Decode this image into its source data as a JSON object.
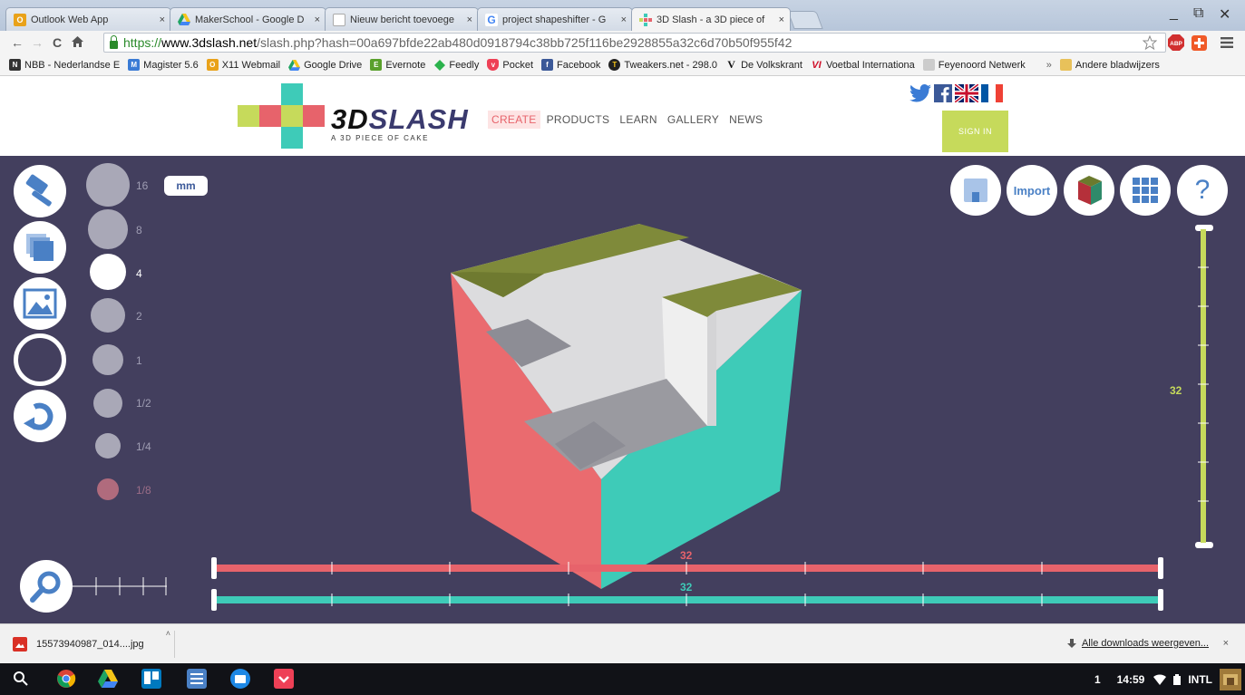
{
  "browser": {
    "tabs": [
      {
        "label": "Outlook Web App",
        "icon": "outlook-icon",
        "color": "#e9a21a"
      },
      {
        "label": "MakerSchool - Google D",
        "icon": "google-drive-icon",
        "color": "#2d8a4a"
      },
      {
        "label": "Nieuw bericht toevoege",
        "icon": "blank-page-icon",
        "color": "#ffffff"
      },
      {
        "label": "project shapeshifter - G",
        "icon": "google-icon",
        "color": "#4285f4"
      },
      {
        "label": "3D Slash - a 3D piece of",
        "icon": "3dslash-icon",
        "color": "#e7636b"
      }
    ],
    "tab_close": "×",
    "window_controls": [
      "_",
      "⧉",
      "✕"
    ],
    "address": {
      "https": "https://",
      "host": "www.3dslash.net",
      "rest": "/slash.php?hash=00a697bfde22ab480d0918794c38bb725f116be2928855a32c6d70b50f955f42"
    },
    "extensions": {
      "adblock": "ABP"
    },
    "bookmarks": [
      {
        "label": "NBB - Nederlandse E",
        "icon": "nbb-icon",
        "color": "#333333"
      },
      {
        "label": "Magister 5.6",
        "icon": "magister-icon",
        "color": "#3a7bd5"
      },
      {
        "label": "X11 Webmail",
        "icon": "webmail-icon",
        "color": "#e9a21a"
      },
      {
        "label": "Google Drive",
        "icon": "google-drive-icon",
        "color": "#2d8a4a"
      },
      {
        "label": "Evernote",
        "icon": "evernote-icon",
        "color": "#5aa02c"
      },
      {
        "label": "Feedly",
        "icon": "feedly-icon",
        "color": "#2bb24c"
      },
      {
        "label": "Pocket",
        "icon": "pocket-icon",
        "color": "#ee4056"
      },
      {
        "label": "Facebook",
        "icon": "facebook-icon",
        "color": "#3b5998"
      },
      {
        "label": "Tweakers.net - 298.0",
        "icon": "tweakers-icon",
        "color": "#222222"
      },
      {
        "label": "De Volkskrant",
        "icon": "volkskrant-icon",
        "color": "#111111"
      },
      {
        "label": "Voetbal Internationa",
        "icon": "vi-icon",
        "color": "#d0112b"
      },
      {
        "label": "Feyenoord Netwerk",
        "icon": "feyenoord-icon",
        "color": "#bbbbbb"
      }
    ],
    "bookmarks_more": "»",
    "other_bookmarks": "Andere bladwijzers"
  },
  "site": {
    "brand_part1": "3D",
    "brand_part2": "SLASH",
    "tagline": "A 3D PIECE OF CAKE",
    "nav": [
      "CREATE",
      "PRODUCTS",
      "LEARN",
      "GALLERY",
      "NEWS"
    ],
    "active_nav": "CREATE",
    "sign_in": "SIGN IN",
    "colors": {
      "green": "#c6da5b",
      "red": "#e7636b",
      "teal": "#3ecbb8",
      "purple": "#433f5e"
    }
  },
  "editor": {
    "tools": [
      "hammer-icon",
      "layers-icon",
      "image-icon",
      "ring-icon",
      "undo-icon"
    ],
    "sizes": [
      "16",
      "8",
      "4",
      "2",
      "1",
      "1/2",
      "1/4",
      "1/8"
    ],
    "selected_size": "4",
    "unit": "mm",
    "import_label": "Import",
    "help_label": "?",
    "slider_x": "32",
    "slider_y": "32",
    "slider_z": "32"
  },
  "downloads": {
    "file": "15573940987_014....jpg",
    "show_all": "Alle downloads weergeven...",
    "close": "×"
  },
  "shelf": {
    "badge": "1",
    "time": "14:59",
    "input": "INTL"
  }
}
